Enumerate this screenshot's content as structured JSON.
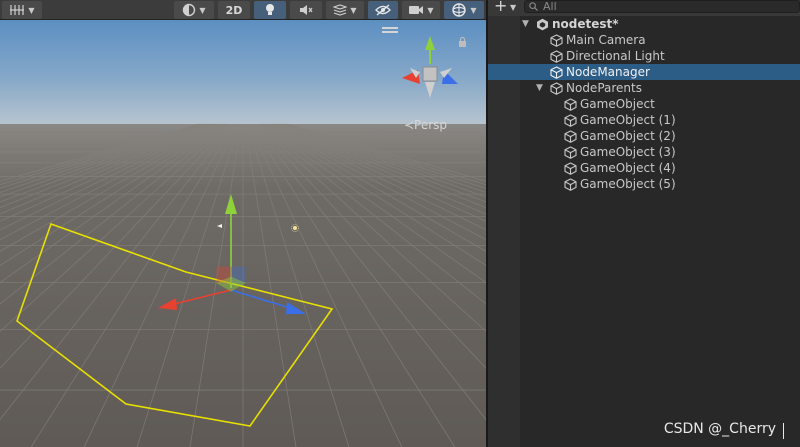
{
  "scene_toolbar": {
    "mode_2d_label": "2D",
    "buttons": [
      {
        "icon": "grid-snap-icon"
      },
      {
        "icon": "shading-mode-icon"
      },
      {
        "icon": "lighting-toggle-icon"
      },
      {
        "icon": "audio-mute-icon"
      },
      {
        "icon": "effects-icon"
      },
      {
        "icon": "scene-visibility-icon"
      },
      {
        "icon": "camera-icon"
      },
      {
        "icon": "gizmos-icon"
      }
    ]
  },
  "scene_view": {
    "projection_label": "≺Persp",
    "path_color": "#e8e000",
    "gizmo_colors": {
      "x": "#e8412f",
      "y": "#8fd13a",
      "z": "#3a6fe8"
    }
  },
  "hierarchy": {
    "add_label": "+",
    "search_placeholder": "All",
    "items": [
      {
        "label": "nodetest*",
        "depth": 0,
        "expanded": true,
        "root": true
      },
      {
        "label": "Main Camera",
        "depth": 1
      },
      {
        "label": "Directional Light",
        "depth": 1
      },
      {
        "label": "NodeManager",
        "depth": 1,
        "selected": true
      },
      {
        "label": "NodeParents",
        "depth": 1,
        "expanded": true
      },
      {
        "label": "GameObject",
        "depth": 2
      },
      {
        "label": "GameObject (1)",
        "depth": 2
      },
      {
        "label": "GameObject (2)",
        "depth": 2
      },
      {
        "label": "GameObject (3)",
        "depth": 2
      },
      {
        "label": "GameObject (4)",
        "depth": 2
      },
      {
        "label": "GameObject (5)",
        "depth": 2
      }
    ]
  },
  "watermark": "CSDN @_Cherry"
}
